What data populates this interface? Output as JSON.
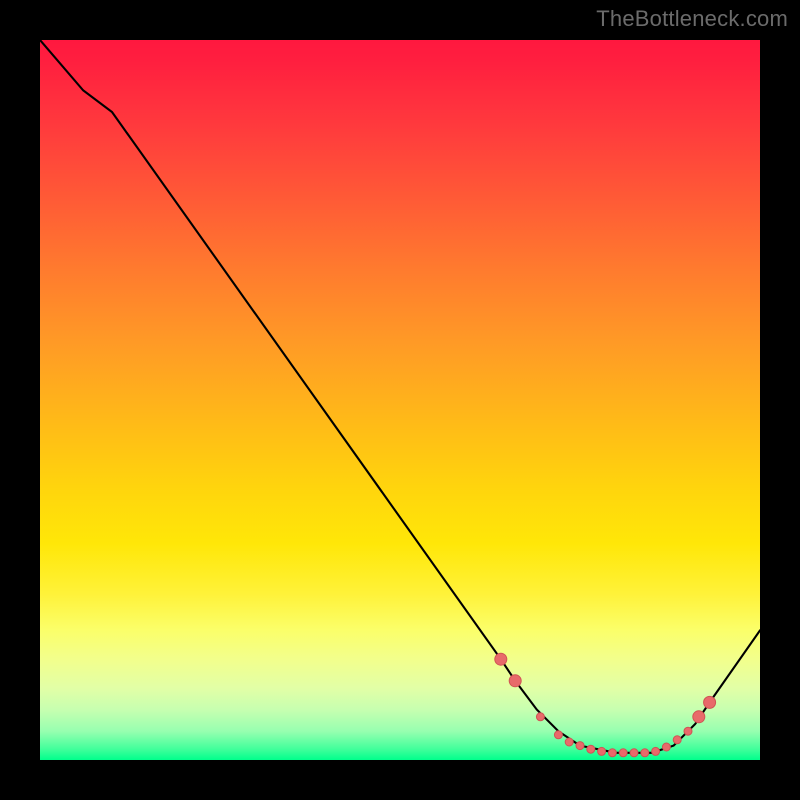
{
  "watermark": "TheBottleneck.com",
  "chart_data": {
    "type": "line",
    "title": "",
    "xlabel": "",
    "ylabel": "",
    "xlim": [
      0,
      100
    ],
    "ylim": [
      0,
      100
    ],
    "grid": false,
    "series": [
      {
        "name": "curve",
        "color": "#000000",
        "points": [
          {
            "x": 0,
            "y": 100
          },
          {
            "x": 6,
            "y": 93
          },
          {
            "x": 10,
            "y": 90
          },
          {
            "x": 64,
            "y": 14
          },
          {
            "x": 66,
            "y": 11
          },
          {
            "x": 69,
            "y": 7
          },
          {
            "x": 72,
            "y": 4
          },
          {
            "x": 75,
            "y": 2
          },
          {
            "x": 80,
            "y": 1
          },
          {
            "x": 85,
            "y": 1
          },
          {
            "x": 88,
            "y": 2
          },
          {
            "x": 91,
            "y": 5
          },
          {
            "x": 93,
            "y": 8
          },
          {
            "x": 100,
            "y": 18
          }
        ]
      }
    ],
    "markers": [
      {
        "x": 64,
        "y": 14
      },
      {
        "x": 66,
        "y": 11
      },
      {
        "x": 69.5,
        "y": 6
      },
      {
        "x": 72,
        "y": 3.5
      },
      {
        "x": 73.5,
        "y": 2.5
      },
      {
        "x": 75,
        "y": 2
      },
      {
        "x": 76.5,
        "y": 1.5
      },
      {
        "x": 78,
        "y": 1.2
      },
      {
        "x": 79.5,
        "y": 1
      },
      {
        "x": 81,
        "y": 1
      },
      {
        "x": 82.5,
        "y": 1
      },
      {
        "x": 84,
        "y": 1
      },
      {
        "x": 85.5,
        "y": 1.2
      },
      {
        "x": 87,
        "y": 1.8
      },
      {
        "x": 88.5,
        "y": 2.8
      },
      {
        "x": 90,
        "y": 4
      },
      {
        "x": 91.5,
        "y": 6
      },
      {
        "x": 93,
        "y": 8
      }
    ],
    "marker_style": {
      "fill": "#e86a6a",
      "stroke": "#d05454",
      "radius_small": 4,
      "radius_large": 6
    },
    "gradient_colors": {
      "top": "#ff183f",
      "bottom": "#00ff8c"
    }
  }
}
